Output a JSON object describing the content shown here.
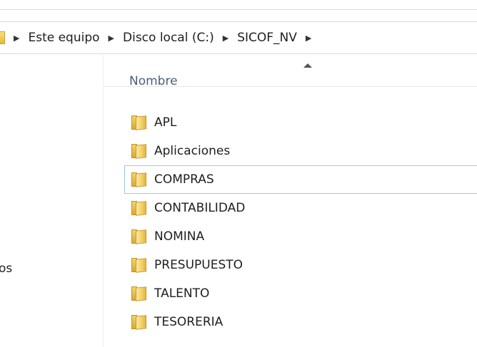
{
  "breadcrumb": {
    "items": [
      {
        "label": "Este equipo"
      },
      {
        "label": "Disco local (C:)"
      },
      {
        "label": "SICOF_NV"
      }
    ]
  },
  "nav_pane": {
    "partial_label": "os"
  },
  "file_list": {
    "column_header": "Nombre",
    "sort": "ascending",
    "focused_index": 2,
    "items": [
      {
        "name": "APL",
        "icon": "folder-icon"
      },
      {
        "name": "Aplicaciones",
        "icon": "folder-icon"
      },
      {
        "name": "COMPRAS",
        "icon": "folder-icon"
      },
      {
        "name": "CONTABILIDAD",
        "icon": "folder-icon"
      },
      {
        "name": "NOMINA",
        "icon": "folder-icon"
      },
      {
        "name": "PRESUPUESTO",
        "icon": "folder-icon"
      },
      {
        "name": "TALENTO",
        "icon": "folder-icon"
      },
      {
        "name": "TESORERIA",
        "icon": "folder-icon"
      }
    ]
  },
  "colors": {
    "focus_border": "#99c9ef",
    "header_text": "#4c607a",
    "folder_yellow": "#f3cf63"
  }
}
